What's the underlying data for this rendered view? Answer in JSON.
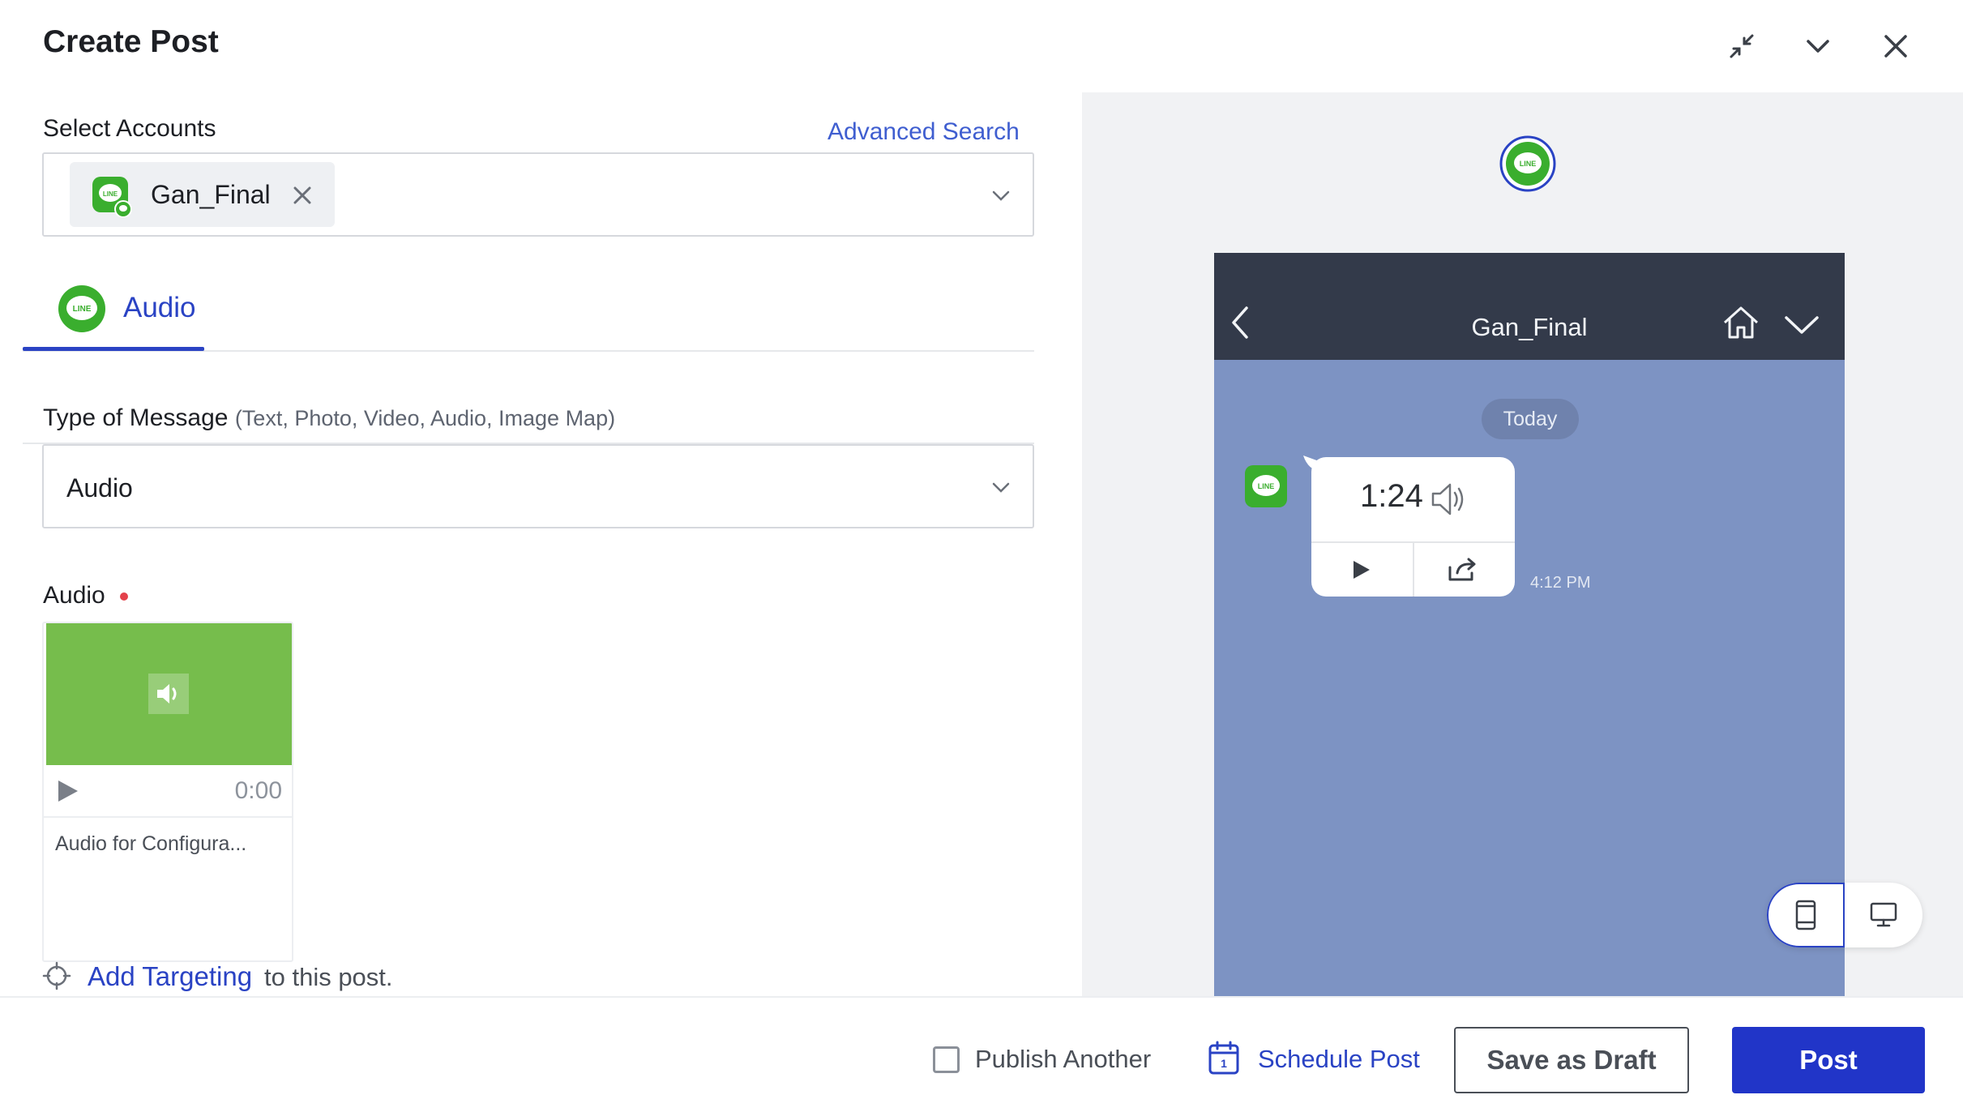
{
  "header": {
    "title": "Create Post",
    "icons": [
      "collapse-icon",
      "chevron-down-icon",
      "close-icon"
    ]
  },
  "form": {
    "select_accounts_label": "Select Accounts",
    "advanced_search_link": "Advanced Search",
    "selected_account": "Gan_Final",
    "tab_label": "Audio",
    "message_type_label": "Type of Message",
    "message_type_hint": "(Text, Photo, Video, Audio, Image Map)",
    "message_type_value": "Audio",
    "audio_label": "Audio",
    "audio_time": "0:00",
    "audio_name": "Audio for Configura...",
    "targeting_link": "Add Targeting",
    "targeting_suffix": "to this post."
  },
  "preview": {
    "chat_title": "Gan_Final",
    "day_badge": "Today",
    "audio_duration": "1:24",
    "message_time": "4:12 PM"
  },
  "footer": {
    "publish_another": "Publish Another",
    "schedule_post": "Schedule Post",
    "save_draft": "Save as Draft",
    "post": "Post"
  },
  "colors": {
    "accent": "#2135c8",
    "line_green": "#3aae2e",
    "phone_bg": "#7d93c3",
    "phone_header": "#333a4a",
    "required_dot": "#e4424b"
  }
}
